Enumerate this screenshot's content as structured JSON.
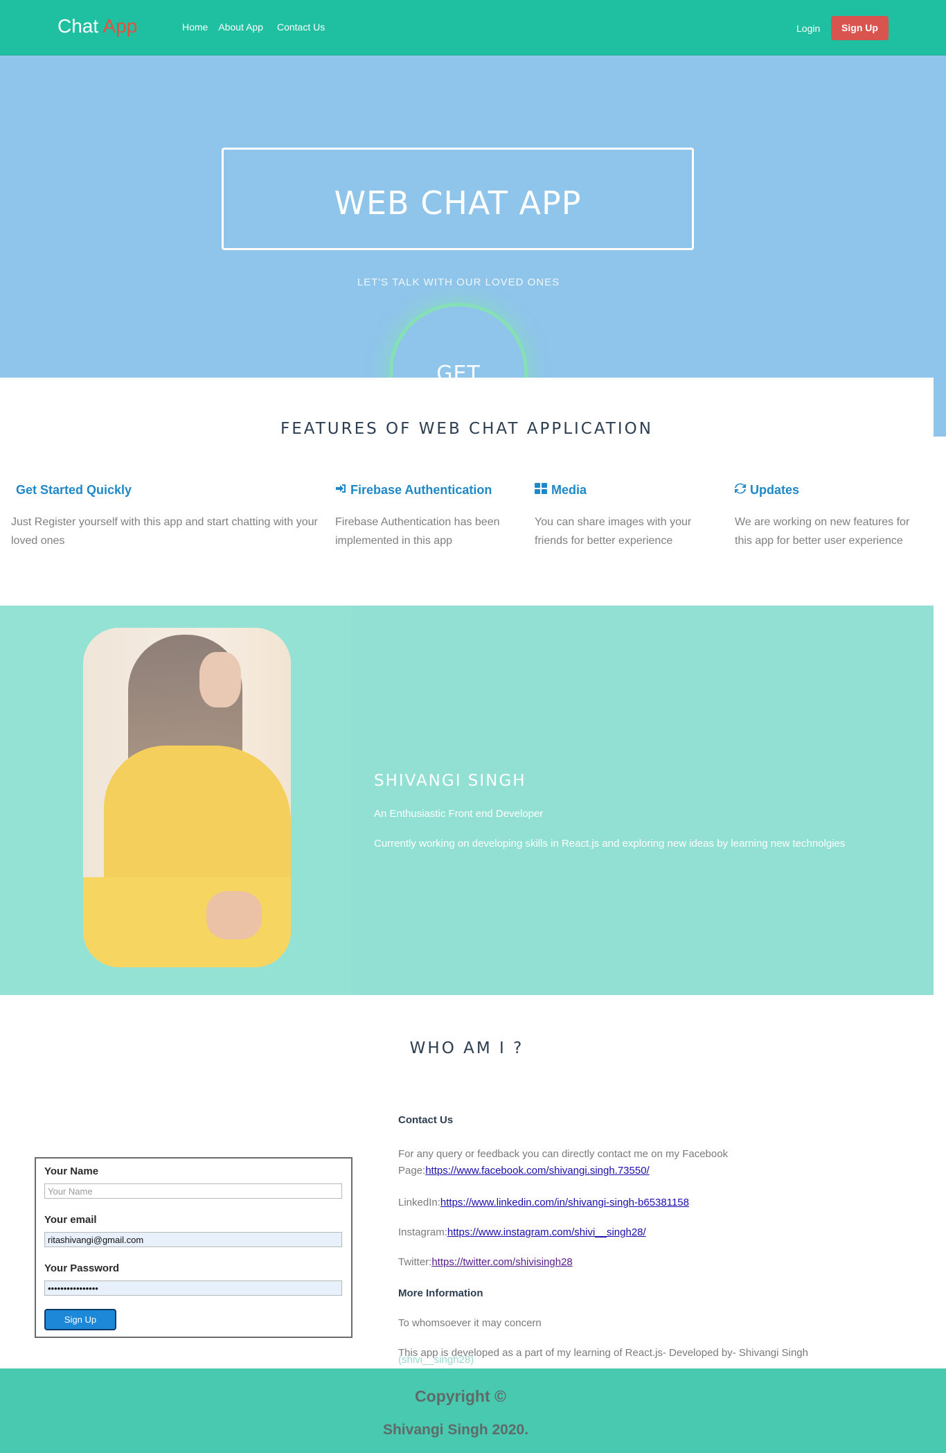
{
  "navbar": {
    "brand_main": "Chat",
    "brand_accent": "App",
    "links": [
      "Home",
      "About App",
      "Contact Us"
    ],
    "login": "Login",
    "signup": "Sign Up"
  },
  "hero": {
    "title": "WEB CHAT APP",
    "subtitle": "LET'S TALK WITH OUR LOVED ONES",
    "cta": "GET STARTED"
  },
  "features": {
    "title": "FEATURES OF WEB CHAT APPLICATION",
    "items": [
      {
        "icon": "none",
        "title": "Get Started Quickly",
        "text": "Just Register yourself with this app and start chatting with your loved ones"
      },
      {
        "icon": "sign-in-icon",
        "title": "Firebase Authentication",
        "text": "Firebase Authentication has been implemented in this app"
      },
      {
        "icon": "grid-icon",
        "title": "Media",
        "text": "You can share images with your friends for better experience"
      },
      {
        "icon": "refresh-icon",
        "title": "Updates",
        "text": "We are working on new features for this app for better user experience"
      }
    ]
  },
  "about": {
    "name": "SHIVANGI SINGH",
    "tagline": "An Enthusiastic Front end Developer",
    "description": "Currently working on developing skills in React.js and exploring new ideas by learning new technolgies"
  },
  "who": {
    "title": "WHO AM I ?"
  },
  "form": {
    "name_label": "Your Name",
    "name_placeholder": "Your Name",
    "email_label": "Your email",
    "email_value": "ritashivangi@gmail.com",
    "password_label": "Your Password",
    "password_value": "••••••••••••••••",
    "submit": "Sign Up"
  },
  "contact": {
    "heading": "Contact Us",
    "facebook_text": "For any query or feedback you can directly contact me on my Facebook Page:",
    "facebook_url": "https://www.facebook.com/shivangi.singh.73550/",
    "linkedin_label": "LinkedIn:",
    "linkedin_url": "https://www.linkedin.com/in/shivangi-singh-b65381158",
    "instagram_label": "Instagram:",
    "instagram_url": "https://www.instagram.com/shivi__singh28/",
    "twitter_label": "Twitter:",
    "twitter_url": "https://twitter.com/shivisingh28",
    "more_heading": "More Information",
    "concern": "To whomsoever it may concern",
    "developed": "This app is developed as a part of my learning of React.js- Developed by- Shivangi Singh",
    "handle": "(shivi__singh28)"
  },
  "footer": {
    "line1": "Copyright ©",
    "line2": "Shivangi Singh 2020."
  },
  "colors": {
    "navbar": "#1fbfa2",
    "hero": "#8fc5ea",
    "signup_button": "#d9534f",
    "feature_heading": "#1e88c8",
    "about_bg": "#91e0d3",
    "footer": "#48c9b0"
  }
}
